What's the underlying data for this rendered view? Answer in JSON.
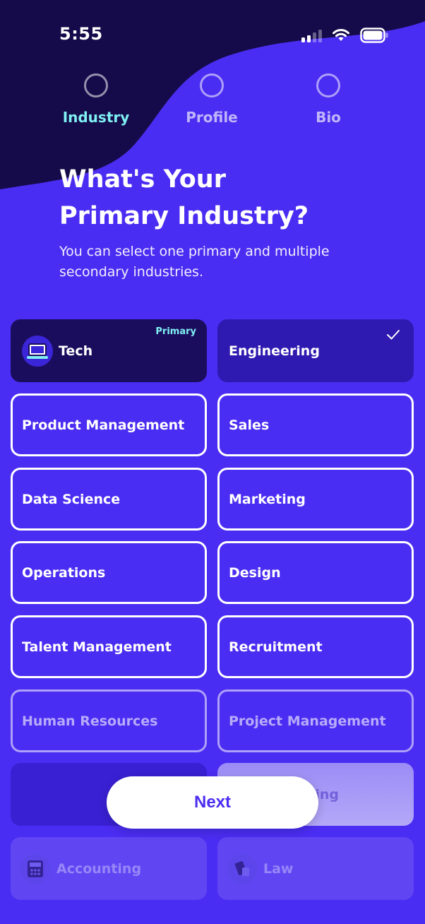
{
  "status_bar": {
    "time": "5:55",
    "icons": [
      "cellular-signal-icon",
      "wifi-icon",
      "battery-icon"
    ]
  },
  "stepper": {
    "steps": [
      {
        "label": "Industry",
        "active": true
      },
      {
        "label": "Profile",
        "active": false
      },
      {
        "label": "Bio",
        "active": false
      }
    ]
  },
  "heading": {
    "line1": "What's Your",
    "line2": "Primary Industry?",
    "subtext": "You can select one primary and multiple secondary industries."
  },
  "industries": [
    {
      "label": "Tech",
      "state": "primary",
      "badge": "Primary",
      "icon": "laptop-icon"
    },
    {
      "label": "Engineering",
      "state": "selected",
      "icon": "checkmark-icon"
    },
    {
      "label": "Product Management",
      "state": "default"
    },
    {
      "label": "Sales",
      "state": "default"
    },
    {
      "label": "Data Science",
      "state": "default"
    },
    {
      "label": "Marketing",
      "state": "default"
    },
    {
      "label": "Operations",
      "state": "default"
    },
    {
      "label": "Design",
      "state": "default"
    },
    {
      "label": "Talent Management",
      "state": "default"
    },
    {
      "label": "Recruitment",
      "state": "default"
    },
    {
      "label": "Human Resources",
      "state": "faded"
    },
    {
      "label": "Project Management",
      "state": "faded"
    },
    {
      "label": "",
      "state": "obscured"
    },
    {
      "label": "ing",
      "state": "obscured-light"
    },
    {
      "label": "Accounting",
      "state": "ghost",
      "icon": "calculator-icon"
    },
    {
      "label": "Law",
      "state": "ghost",
      "icon": "gavel-icon"
    }
  ],
  "next_button": {
    "label": "Next"
  },
  "colors": {
    "background": "#4a2df2",
    "header_wave": "#150b4a",
    "accent_cyan": "#7ff0f3",
    "primary_card": "#1b0d5e",
    "selected_card": "#2e1ab0"
  }
}
